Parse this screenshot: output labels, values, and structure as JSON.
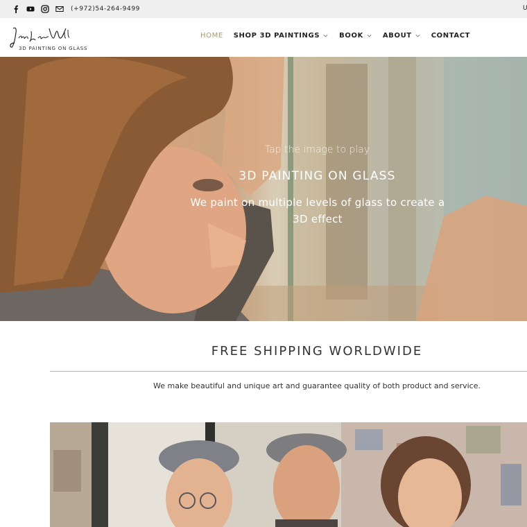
{
  "topbar": {
    "phone": "(+972)54-264-9499",
    "social_icons": [
      "facebook-icon",
      "youtube-icon",
      "instagram-icon",
      "mail-icon"
    ],
    "right_cut": "U"
  },
  "header": {
    "logo_script": "Jean Pierre Weill",
    "logo_subtitle": "3D PAINTING ON GLASS",
    "nav": [
      {
        "label": "HOME",
        "active": true,
        "dropdown": false
      },
      {
        "label": "SHOP 3D PAINTINGS",
        "active": false,
        "dropdown": true
      },
      {
        "label": "BOOK",
        "active": false,
        "dropdown": true
      },
      {
        "label": "ABOUT",
        "active": false,
        "dropdown": true
      },
      {
        "label": "CONTACT",
        "active": false,
        "dropdown": false
      }
    ],
    "accent_color": "#a99a66"
  },
  "hero": {
    "tap_text": "Tap the image to play",
    "title": "3D PAINTING ON GLASS",
    "description": "We paint on multiple levels of glass to create a 3D effect"
  },
  "shipping": {
    "title": "FREE SHIPPING WORLDWIDE",
    "description": "We make beautiful and unique art and guarantee quality of both product and service."
  }
}
